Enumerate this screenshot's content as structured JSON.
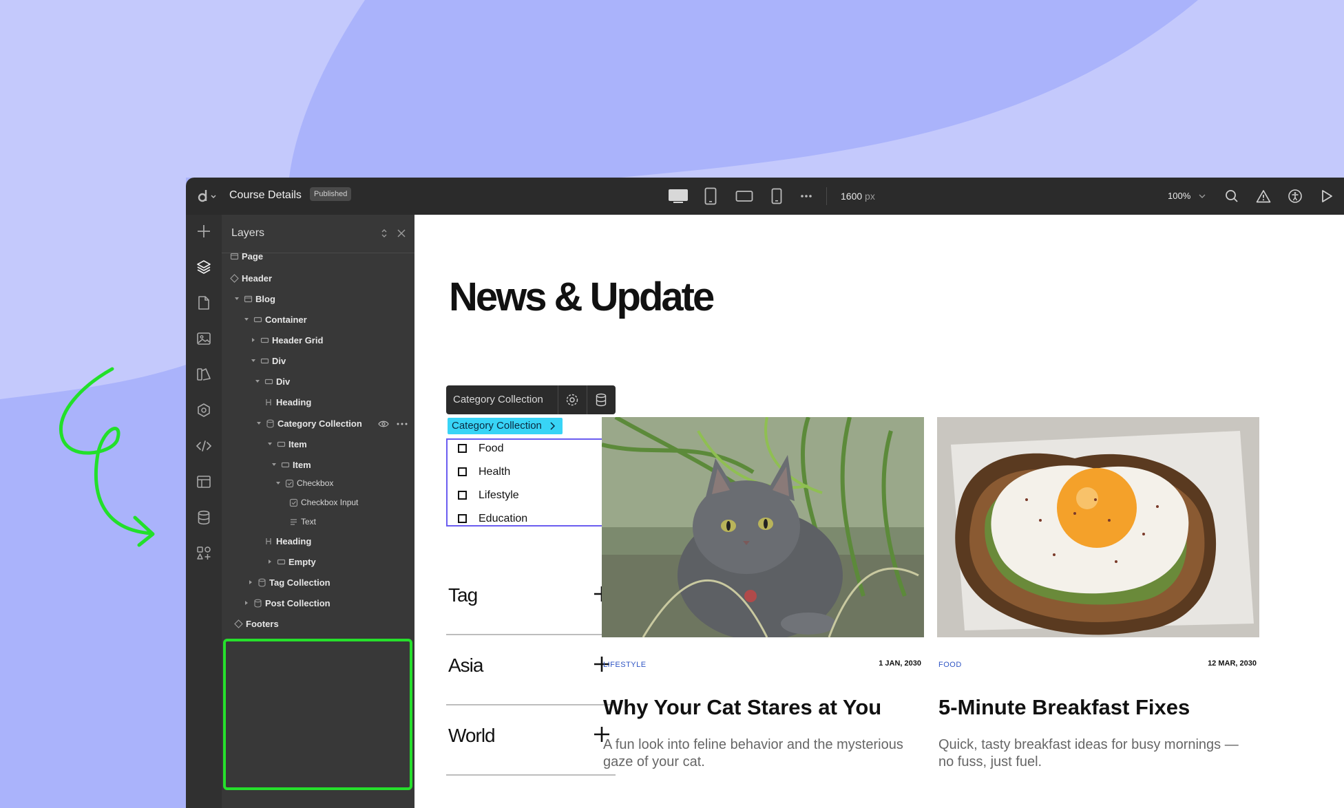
{
  "app": {
    "title": "Course Details",
    "badge": "Published",
    "width_value": "1600",
    "width_unit": "px",
    "zoom": "100%"
  },
  "layers": {
    "title": "Layers",
    "items": [
      {
        "label": "Page"
      },
      {
        "label": "Header"
      },
      {
        "label": "Blog"
      },
      {
        "label": "Container"
      },
      {
        "label": "Header Grid"
      },
      {
        "label": "Div"
      },
      {
        "label": "Div"
      },
      {
        "label": "Heading"
      },
      {
        "label": "Category Collection"
      },
      {
        "label": "Item"
      },
      {
        "label": "Item"
      },
      {
        "label": "Checkbox"
      },
      {
        "label": "Checkbox Input"
      },
      {
        "label": "Text"
      },
      {
        "label": "Heading"
      },
      {
        "label": "Empty"
      },
      {
        "label": "Tag Collection"
      },
      {
        "label": "Post Collection"
      },
      {
        "label": "Footers"
      }
    ]
  },
  "canvas": {
    "heading": "News & Update",
    "selection_toolbar_label": "Category Collection",
    "selection_tag": "Category Collection",
    "checkboxes": [
      "Food",
      "Health",
      "Lifestyle",
      "Education"
    ],
    "accordions": [
      "Tag",
      "Asia",
      "World"
    ],
    "posts": [
      {
        "category": "LIFESTYLE",
        "date": "1 JAN, 2030",
        "title": "Why Your Cat Stares at You",
        "description": "A fun look into feline behavior and the mysterious gaze of your cat."
      },
      {
        "category": "FOOD",
        "date": "12 MAR, 2030",
        "title": "5-Minute Breakfast Fixes",
        "description": "Quick, tasty breakfast ideas for busy mornings — no fuss, just fuel."
      }
    ]
  },
  "colors": {
    "highlight": "#26e02c",
    "selection": "#6a5cf0",
    "tag_bg": "#38d4f6",
    "category_link": "#2f55c4"
  }
}
